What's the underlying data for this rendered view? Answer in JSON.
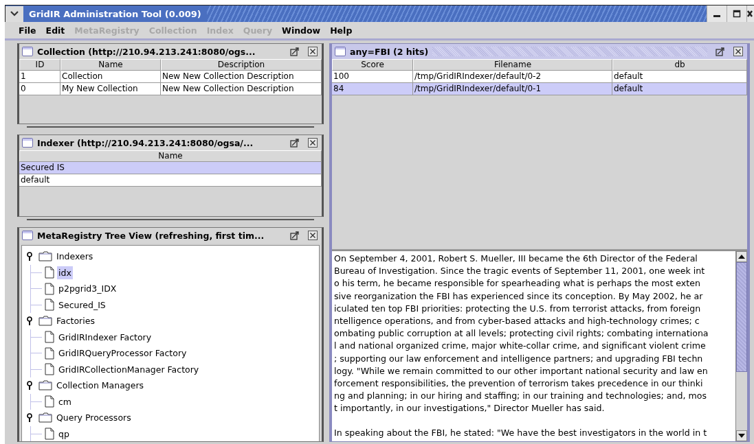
{
  "window": {
    "title": "GridIR Administration Tool (0.009)"
  },
  "menu": [
    {
      "label": "File",
      "disabled": false
    },
    {
      "label": "Edit",
      "disabled": false
    },
    {
      "label": "MetaRegistry",
      "disabled": true
    },
    {
      "label": "Collection",
      "disabled": true
    },
    {
      "label": "Index",
      "disabled": true
    },
    {
      "label": "Query",
      "disabled": true
    },
    {
      "label": "Window",
      "disabled": false
    },
    {
      "label": "Help",
      "disabled": false
    }
  ],
  "collection_frame": {
    "title": "Collection (http://210.94.213.241:8080/ogs...",
    "active": false,
    "table": {
      "columns": [
        "ID",
        "Name",
        "Description"
      ],
      "rows": [
        {
          "cells": [
            "1",
            "Collection",
            "New New Collection Description"
          ],
          "selected": false
        },
        {
          "cells": [
            "0",
            "My New Collection",
            "New New Collection Description"
          ],
          "selected": false
        }
      ]
    }
  },
  "indexer_frame": {
    "title": "Indexer (http://210.94.213.241:8080/ogsa/...",
    "active": false,
    "table": {
      "columns": [
        "Name"
      ],
      "rows": [
        {
          "cells": [
            "Secured IS"
          ],
          "selected": true
        },
        {
          "cells": [
            "default"
          ],
          "selected": false
        }
      ]
    }
  },
  "tree_frame": {
    "title": "MetaRegistry Tree View (refreshing, first tim...",
    "active": false,
    "nodes": [
      {
        "label": "Indexers",
        "selected": false,
        "expanded": true,
        "children": [
          {
            "label": "idx",
            "selected": true
          },
          {
            "label": "p2pgrid3_IDX",
            "selected": false
          },
          {
            "label": "Secured_IS",
            "selected": false
          }
        ]
      },
      {
        "label": "Factories",
        "selected": false,
        "expanded": true,
        "children": [
          {
            "label": "GridIRIndexer Factory",
            "selected": false
          },
          {
            "label": "GridIRQueryProcessor Factory",
            "selected": false
          },
          {
            "label": "GridIRCollectionManager Factory",
            "selected": false
          }
        ]
      },
      {
        "label": "Collection Managers",
        "selected": false,
        "expanded": true,
        "children": [
          {
            "label": "cm",
            "selected": false
          }
        ]
      },
      {
        "label": "Query Processors",
        "selected": false,
        "expanded": true,
        "children": [
          {
            "label": "qp",
            "selected": false
          }
        ]
      }
    ]
  },
  "results_frame": {
    "title": "any=FBI (2 hits)",
    "active": true,
    "table": {
      "columns": [
        "Score",
        "Filename",
        "db"
      ],
      "rows": [
        {
          "cells": [
            "100",
            "/tmp/GridIRIndexer/default/0-2",
            "default"
          ],
          "selected": false
        },
        {
          "cells": [
            "84",
            "/tmp/GridIRIndexer/default/0-1",
            "default"
          ],
          "selected": true
        }
      ]
    },
    "document": {
      "paragraphs": [
        {
          "lines": [
            "On September 4, 2001, Robert S. Mueller, III became the 6th Director of the Federal",
            "Bureau of Investigation. Since the tragic events of September 11, 2001, one week int",
            "o his term, he became responsible for spearheading what is perhaps the most exten",
            "sive reorganization the FBI has experienced since its conception. By May 2002, he ar",
            "iculated ten top FBI priorities: protecting the U.S. from terrorist attacks, from foreign",
            "ntelligence operations, and from cyber-based attacks and high-technology crimes; c",
            "ombating public corruption at all levels; protecting civil rights; combating internationa",
            "l and national organized crime, major white-collar crime, and significant violent crime",
            "; supporting our law enforcement and intelligence partners; and upgrading FBI techn",
            "logy. \"While we remain committed to our other important national security and law en",
            "forcement responsibilities, the prevention of terrorism takes precedence in our thinki",
            "ng and planning; in our hiring and staffing; in our training and technologies; and, mos",
            "t importantly, in our investigations,\" Director Mueller has said."
          ]
        },
        {
          "lines": [
            "In speaking about the FBI, he stated: \"We have the best investigators in the world in t"
          ]
        }
      ]
    }
  }
}
